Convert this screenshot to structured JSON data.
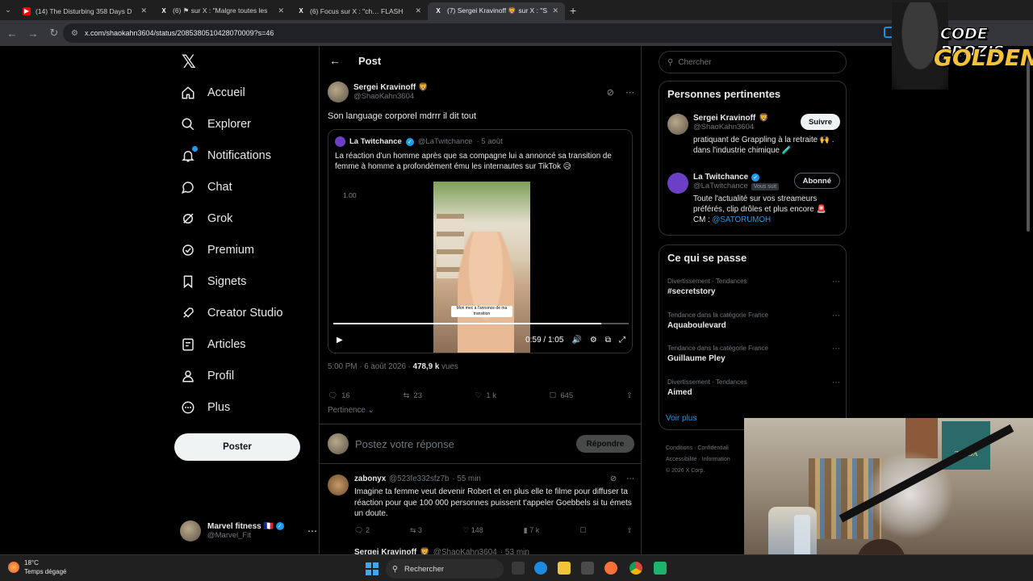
{
  "browser": {
    "tabs": [
      {
        "label": "(14) The Disturbing 358 Days D",
        "icon": "youtube-icon",
        "color": "#ff0000"
      },
      {
        "label": "(6) ⚑ sur X : \"Malgre toutes les",
        "icon": "x-icon",
        "color": "#ffffff"
      },
      {
        "label": "(6) Focus sur X : \"ch… FLASH",
        "icon": "x-icon",
        "color": "#ffffff"
      },
      {
        "label": "(7) Sergei Kravinoff 🦁 sur X : \"S",
        "icon": "x-icon",
        "color": "#ffffff",
        "active": true
      }
    ],
    "url": "x.com/shaokahn3604/status/2085380510428070009?s=46"
  },
  "nav": {
    "items": [
      {
        "label": "Accueil",
        "icon": "home-icon"
      },
      {
        "label": "Explorer",
        "icon": "search-icon"
      },
      {
        "label": "Notifications",
        "icon": "bell-icon"
      },
      {
        "label": "Chat",
        "icon": "chat-icon"
      },
      {
        "label": "Grok",
        "icon": "grok-icon"
      },
      {
        "label": "Premium",
        "icon": "verified-icon"
      },
      {
        "label": "Signets",
        "icon": "bookmark-icon"
      },
      {
        "label": "Creator Studio",
        "icon": "rocket-icon"
      },
      {
        "label": "Articles",
        "icon": "article-icon"
      },
      {
        "label": "Profil",
        "icon": "person-icon"
      },
      {
        "label": "Plus",
        "icon": "more-circle-icon"
      }
    ],
    "post_button": "Poster",
    "account": {
      "name": "Marvel fitness",
      "flag": "🇫🇷",
      "handle": "@Marvel_Fit"
    }
  },
  "main": {
    "header_title": "Post",
    "tweet": {
      "author": "Sergei Kravinoff",
      "author_emoji": "🦁",
      "handle": "@ShaoKahn3604",
      "text": "Son language corporel mdrrr il dit tout",
      "quote": {
        "author": "La Twitchance",
        "handle": "@LaTwitchance",
        "date": "· 5 août",
        "text": "La réaction d'un homme après que sa compagne lui a annoncé sa transition de femme à homme a profondément ému les internautes sur TikTok 😥",
        "video": {
          "speed": "1.00",
          "overlay_caption": "Mon mec a l'annonce de ma transition",
          "time": "0:59 / 1:05",
          "progress": 0.907
        }
      },
      "timestamp": "5:00 PM · 6 août 2026 · ",
      "views_count": "478,9 k",
      "views_label": " vues",
      "stats": {
        "replies": "16",
        "reposts": "23",
        "likes": "1 k",
        "bookmarks": "645"
      },
      "sort_label": "Pertinence"
    },
    "reply_placeholder": "Postez votre réponse",
    "reply_button": "Répondre",
    "replies": [
      {
        "author": "zabonyx",
        "handle": "@523fe332sfz7b",
        "time": "· 55 min",
        "text": "Imagine ta femme veut devenir Robert et en plus elle te filme pour diffuser ta réaction pour que 100 000 personnes puissent t'appeler Goebbels si tu émets un doute.",
        "stats": {
          "replies": "2",
          "reposts": "3",
          "likes": "148",
          "views": "7 k"
        }
      },
      {
        "author": "Sergei Kravinoff",
        "author_emoji": "🦁",
        "handle": "@ShaoKahn3604",
        "time": "· 53 min"
      }
    ]
  },
  "right": {
    "search_placeholder": "Chercher",
    "relevant_title": "Personnes pertinentes",
    "people": [
      {
        "name": "Sergei Kravinoff",
        "emoji": "🦁",
        "handle": "@ShaoKahn3604",
        "button": "Suivre",
        "bio": "pratiquant de Grappling à la retraite 🙌 . dans l'industrie chimique 🧪"
      },
      {
        "name": "La Twitchance",
        "handle": "@LaTwitchance",
        "follows_you": "Vous suit",
        "button": "Abonné",
        "bio": "Toute l'actualité sur vos streameurs préférés, clip drôles et plus encore 🚨 CM : ",
        "bio_link": "@SATORUMOH"
      }
    ],
    "trends_title": "Ce qui se passe",
    "trends": [
      {
        "category": "Divertissement · Tendances",
        "name": "#secretstory"
      },
      {
        "category": "Tendance dans la catégorie France",
        "name": "Aquaboulevard"
      },
      {
        "category": "Tendance dans la catégorie France",
        "name": "Guillaume Pley"
      },
      {
        "category": "Divertissement · Tendances",
        "name": "Aimed"
      }
    ],
    "see_more": "Voir plus",
    "footer": [
      "Conditions",
      "Confidentiali",
      "Accessibilité",
      "Information",
      "© 2026 X Corp."
    ]
  },
  "overlay": {
    "promo_line1": "CODE PROZIS",
    "promo_line2": "GOLDENG",
    "webcam_poster_text": "ZELDA"
  },
  "taskbar": {
    "temp": "18°C",
    "weather": "Temps dégagé",
    "search": "Rechercher"
  }
}
